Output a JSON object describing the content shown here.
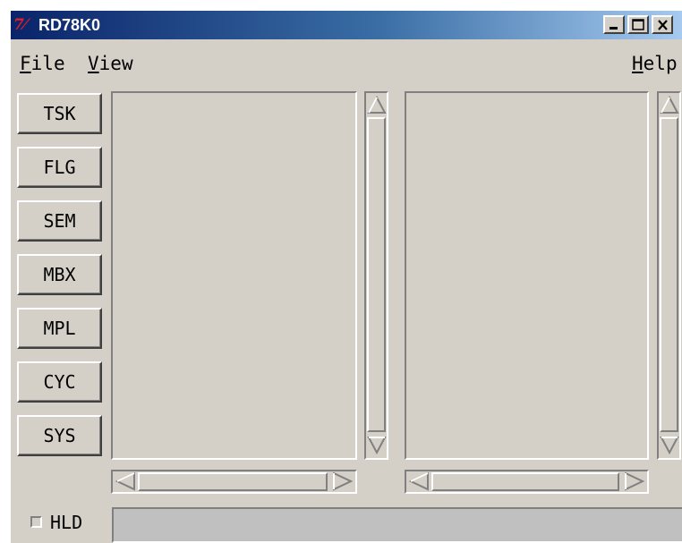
{
  "window": {
    "title": "RD78K0",
    "icon": "tk-feather-icon"
  },
  "title_buttons": [
    "minimize-icon",
    "maximize-icon",
    "close-icon"
  ],
  "menu": {
    "file": {
      "mnemonic": "F",
      "rest": "ile"
    },
    "view": {
      "mnemonic": "V",
      "rest": "iew"
    },
    "help": {
      "mnemonic": "H",
      "rest": "elp"
    }
  },
  "sidebar": {
    "buttons": [
      "TSK",
      "FLG",
      "SEM",
      "MBX",
      "MPL",
      "CYC",
      "SYS"
    ]
  },
  "status": {
    "hold_label": "HLD",
    "hold_checked": false,
    "field_value": ""
  },
  "colors": {
    "face": "#d4d0c8",
    "title_start": "#0a246a",
    "title_end": "#a6caf0",
    "icon_red": "#e0202a"
  }
}
